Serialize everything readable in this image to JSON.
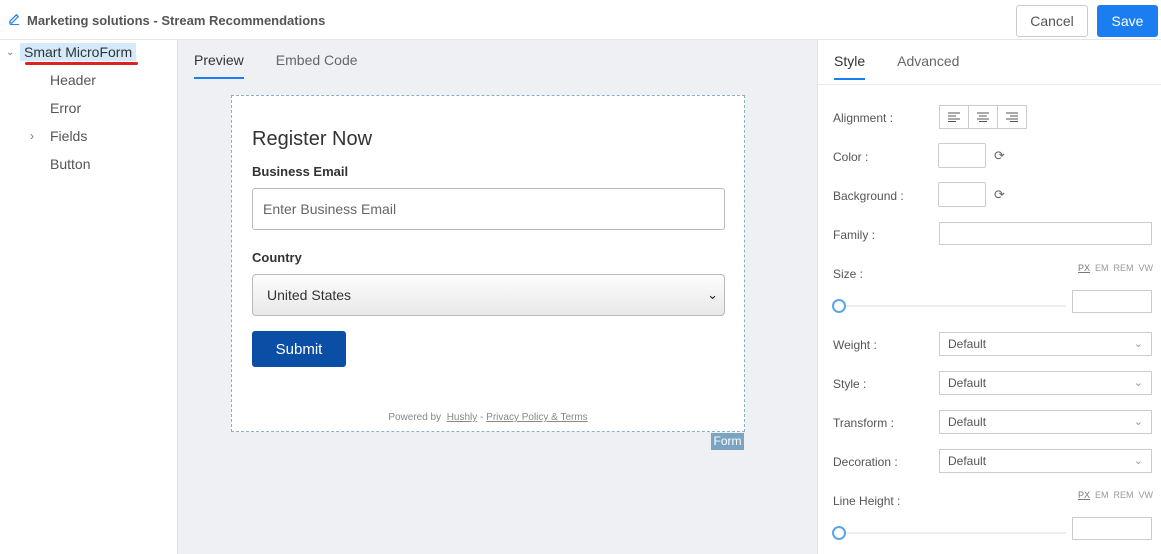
{
  "header": {
    "title": "Marketing solutions - Stream Recommendations",
    "cancel_label": "Cancel",
    "save_label": "Save"
  },
  "tree": {
    "root": "Smart MicroForm",
    "items": [
      "Header",
      "Error",
      "Fields",
      "Button"
    ]
  },
  "center": {
    "tabs": [
      "Preview",
      "Embed Code"
    ],
    "form": {
      "title": "Register Now",
      "email_label": "Business Email",
      "email_placeholder": "Enter Business Email",
      "country_label": "Country",
      "country_value": "United States",
      "submit_label": "Submit",
      "powered_prefix": "Powered by",
      "powered_brand": "Hushly",
      "powered_sep": "-",
      "powered_link": "Privacy Policy & Terms"
    },
    "form_tag": "Form"
  },
  "panel": {
    "tabs": [
      "Style",
      "Advanced"
    ],
    "labels": {
      "alignment": "Alignment :",
      "color": "Color :",
      "background": "Background :",
      "family": "Family :",
      "size": "Size :",
      "weight": "Weight :",
      "style": "Style :",
      "transform": "Transform :",
      "decoration": "Decoration :",
      "line_height": "Line Height :"
    },
    "units": [
      "PX",
      "EM",
      "REM",
      "VW"
    ],
    "weight_value": "Default",
    "style_value": "Default",
    "transform_value": "Default",
    "decoration_value": "Default"
  },
  "colors": {
    "accent": "#1a7ef0",
    "submit": "#0a4ea6",
    "highlight": "#d4eafa",
    "underline": "#e02020"
  }
}
